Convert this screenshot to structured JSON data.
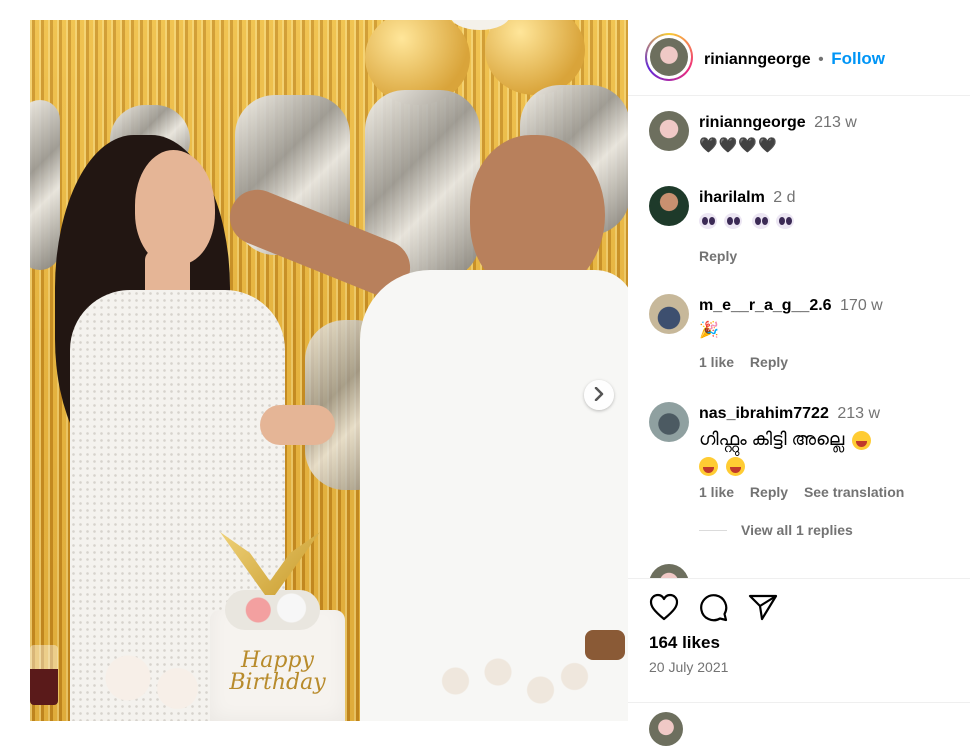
{
  "post": {
    "author": "rinianngeorge",
    "follow_label": "Follow",
    "separator": "•"
  },
  "comments": [
    {
      "username": "rinianngeorge",
      "time": "213 w",
      "text": "🖤🖤🖤🖤",
      "likes": "",
      "reply": "",
      "translate": ""
    },
    {
      "username": "iharilalm",
      "time": "2 d",
      "text": "",
      "likes": "",
      "reply": "Reply",
      "translate": ""
    },
    {
      "username": "m_e__r_a_g__2.6",
      "time": "170 w",
      "text": "🎉",
      "likes": "1 like",
      "reply": "Reply",
      "translate": ""
    },
    {
      "username": "nas_ibrahim7722",
      "time": "213 w",
      "text": "ഗിഫ്റ്റും കിട്ടി അല്ലെ",
      "likes": "1 like",
      "reply": "Reply",
      "translate": "See translation"
    }
  ],
  "view_replies": "View all 1 replies",
  "stats": {
    "likes": "164 likes",
    "date": "20 July 2021"
  },
  "photo": {
    "cake_text_line1": "Happy",
    "cake_text_line2": "Birthday"
  },
  "icons": [
    "heart-icon",
    "comment-icon",
    "share-icon",
    "chevron-right-icon"
  ],
  "colors": {
    "link": "#0095f6",
    "muted": "#737373",
    "gold": "#d6a032"
  }
}
